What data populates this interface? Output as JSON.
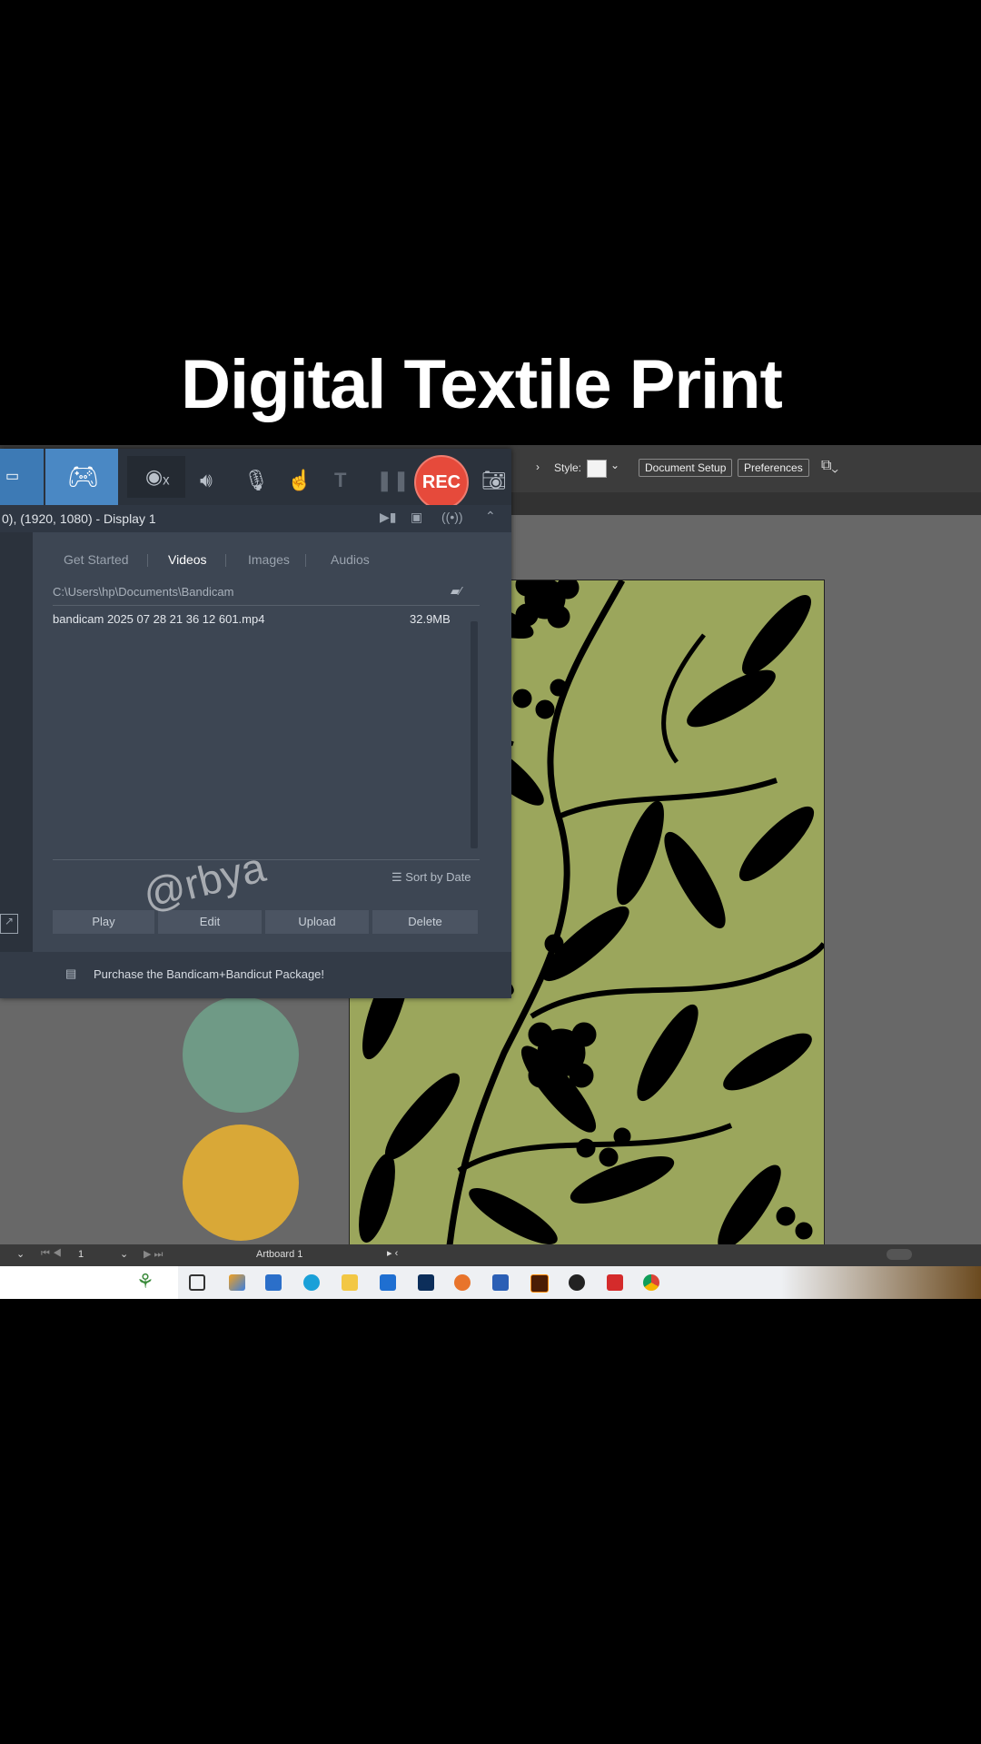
{
  "video_title": "Digital Textile Print",
  "illustrator": {
    "toolbar": {
      "style_label": "Style:",
      "document_setup": "Document Setup",
      "preferences": "Preferences"
    },
    "status": {
      "page_number": "1",
      "artboard_name": "Artboard 1"
    },
    "colors": {
      "canvas_bg": "#686868",
      "pattern_bg": "#9ba65c",
      "pattern_fg": "#000000",
      "swatch_1": "#6f9a86",
      "swatch_2": "#d9a837"
    }
  },
  "bandicam": {
    "rec_label": "REC",
    "display_info": "0), (1920, 1080) - Display 1",
    "tabs": [
      "Get Started",
      "Videos",
      "Images",
      "Audios"
    ],
    "active_tab": "Videos",
    "folder_path": "C:\\Users\\hp\\Documents\\Bandicam",
    "file": {
      "name": "bandicam 2025 07 28 21 36 12 601.mp4",
      "size": "32.9MB"
    },
    "sort_label": "Sort by Date",
    "actions": [
      "Play",
      "Edit",
      "Upload",
      "Delete"
    ],
    "footer_text": "Purchase the Bandicam+Bandicut Package!",
    "accent": "#4a88c4",
    "rec_color": "#e64a3b"
  },
  "watermark": "@rbya"
}
